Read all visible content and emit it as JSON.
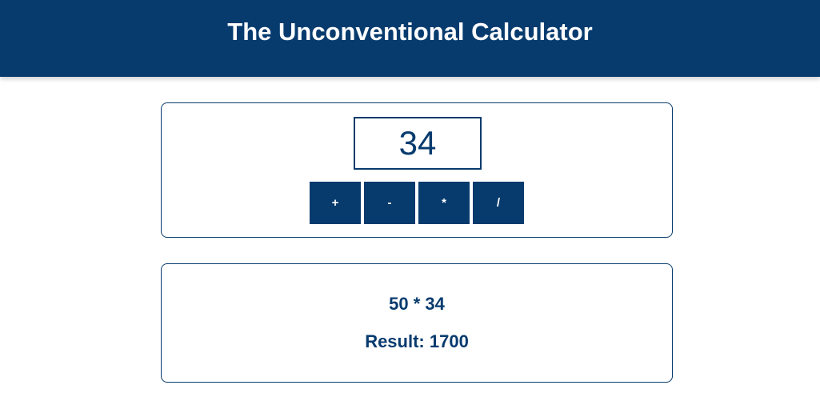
{
  "header": {
    "title": "The Unconventional Calculator"
  },
  "calculator": {
    "input_value": "34",
    "operators": [
      "+",
      "-",
      "*",
      "/"
    ]
  },
  "result_panel": {
    "expression": "50 * 34",
    "result_label": "Result: 1700"
  },
  "colors": {
    "primary": "#073b6e",
    "background": "#ffffff",
    "header_text": "#ffffff"
  }
}
